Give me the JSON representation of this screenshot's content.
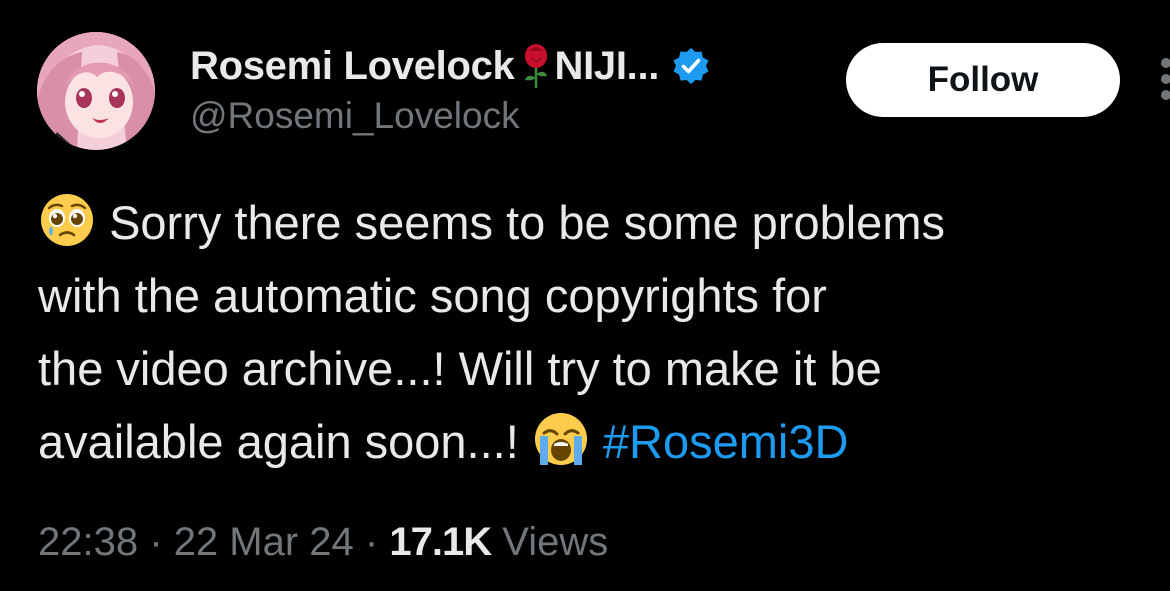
{
  "author": {
    "display_name": "Rosemi Lovelock",
    "name_suffix": "NIJI...",
    "handle": "@Rosemi_Lovelock",
    "avatar_icon": "avatar-anime-girl-pink-hair",
    "name_emoji": "rose-icon",
    "verified_icon": "verified-badge-icon"
  },
  "follow_button": {
    "label": "Follow"
  },
  "tweet": {
    "lead_emoji": "pleading-face-icon",
    "line1": "Sorry there seems to be some problems",
    "line2": "with the automatic song copyrights for",
    "line3": "the video archive...! Will try to make it be",
    "line4": "available again soon...!",
    "trailing_emoji": "loudly-crying-face-icon",
    "hashtag": "#Rosemi3D"
  },
  "meta": {
    "time": "22:38",
    "separator": "·",
    "date": "22 Mar 24",
    "views_count": "17.1K",
    "views_label": "Views"
  },
  "colors": {
    "background": "#000000",
    "text": "#e7e9ea",
    "muted": "#71767b",
    "link": "#1d9bf0",
    "verified": "#1d9bf0"
  }
}
